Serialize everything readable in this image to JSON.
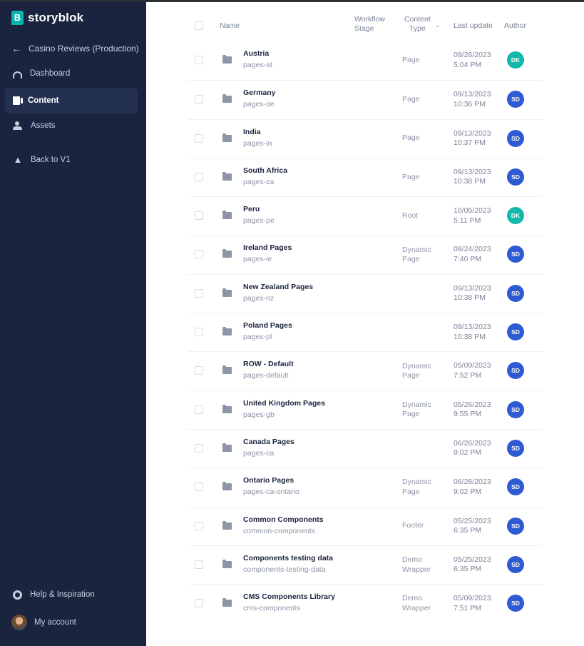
{
  "brand": {
    "name": "storyblok",
    "mark": "B"
  },
  "space": {
    "name": "Casino Reviews (Production)"
  },
  "nav": [
    {
      "label": "Dashboard",
      "icon": "dashboard-icon",
      "active": false
    },
    {
      "label": "Content",
      "icon": "content-icon",
      "active": true
    },
    {
      "label": "Assets",
      "icon": "assets-icon",
      "active": false
    },
    {
      "label": "Back to V1",
      "icon": "rocket-icon",
      "active": false
    }
  ],
  "footer_nav": [
    {
      "label": "Help & Inspiration",
      "icon": "help-icon"
    },
    {
      "label": "My account",
      "icon": "avatar"
    }
  ],
  "columns": {
    "name": "Name",
    "workflow_stage": [
      "Workflow",
      "Stage"
    ],
    "content_type": [
      "Content",
      "Type"
    ],
    "last_update": "Last update",
    "author": "Author"
  },
  "colors": {
    "sidebar": "#1b243f",
    "brand": "#09b3af",
    "author_sd": "#2e5bd3",
    "author_dk": "#12b8ac"
  },
  "rows": [
    {
      "name": "Austria",
      "slug": "pages-at",
      "content_type": [
        "Page"
      ],
      "date": "09/26/2023",
      "time": "5:04 PM",
      "author": "DK"
    },
    {
      "name": "Germany",
      "slug": "pages-de",
      "content_type": [
        "Page"
      ],
      "date": "09/13/2023",
      "time": "10:36 PM",
      "author": "SD"
    },
    {
      "name": "India",
      "slug": "pages-in",
      "content_type": [
        "Page"
      ],
      "date": "09/13/2023",
      "time": "10:37 PM",
      "author": "SD"
    },
    {
      "name": "South Africa",
      "slug": "pages-za",
      "content_type": [
        "Page"
      ],
      "date": "09/13/2023",
      "time": "10:38 PM",
      "author": "SD"
    },
    {
      "name": "Peru",
      "slug": "pages-pe",
      "content_type": [
        "Root"
      ],
      "date": "10/05/2023",
      "time": "5:11 PM",
      "author": "DK"
    },
    {
      "name": "Ireland Pages",
      "slug": "pages-ie",
      "content_type": [
        "Dynamic",
        "Page"
      ],
      "date": "08/24/2023",
      "time": "7:40 PM",
      "author": "SD"
    },
    {
      "name": "New Zealand Pages",
      "slug": "pages-nz",
      "content_type": [],
      "date": "09/13/2023",
      "time": "10:38 PM",
      "author": "SD"
    },
    {
      "name": "Poland Pages",
      "slug": "pages-pl",
      "content_type": [],
      "date": "09/13/2023",
      "time": "10:38 PM",
      "author": "SD"
    },
    {
      "name": "ROW - Default",
      "slug": "pages-default",
      "content_type": [
        "Dynamic",
        "Page"
      ],
      "date": "05/09/2023",
      "time": "7:52 PM",
      "author": "SD"
    },
    {
      "name": "United Kingdom Pages",
      "slug": "pages-gb",
      "content_type": [
        "Dynamic",
        "Page"
      ],
      "date": "05/26/2023",
      "time": "9:55 PM",
      "author": "SD"
    },
    {
      "name": "Canada Pages",
      "slug": "pages-ca",
      "content_type": [],
      "date": "06/26/2023",
      "time": "9:02 PM",
      "author": "SD"
    },
    {
      "name": "Ontario Pages",
      "slug": "pages-ca-ontario",
      "content_type": [
        "Dynamic",
        "Page"
      ],
      "date": "06/26/2023",
      "time": "9:02 PM",
      "author": "SD"
    },
    {
      "name": "Common Components",
      "slug": "common-components",
      "content_type": [
        "Footer"
      ],
      "date": "05/25/2023",
      "time": "6:35 PM",
      "author": "SD"
    },
    {
      "name": "Components testing data",
      "slug": "components-testing-data",
      "content_type": [
        "Demo",
        "Wrapper"
      ],
      "date": "05/25/2023",
      "time": "6:35 PM",
      "author": "SD"
    },
    {
      "name": "CMS Components Library",
      "slug": "cms-components",
      "content_type": [
        "Demo",
        "Wrapper"
      ],
      "date": "05/09/2023",
      "time": "7:51 PM",
      "author": "SD"
    }
  ]
}
